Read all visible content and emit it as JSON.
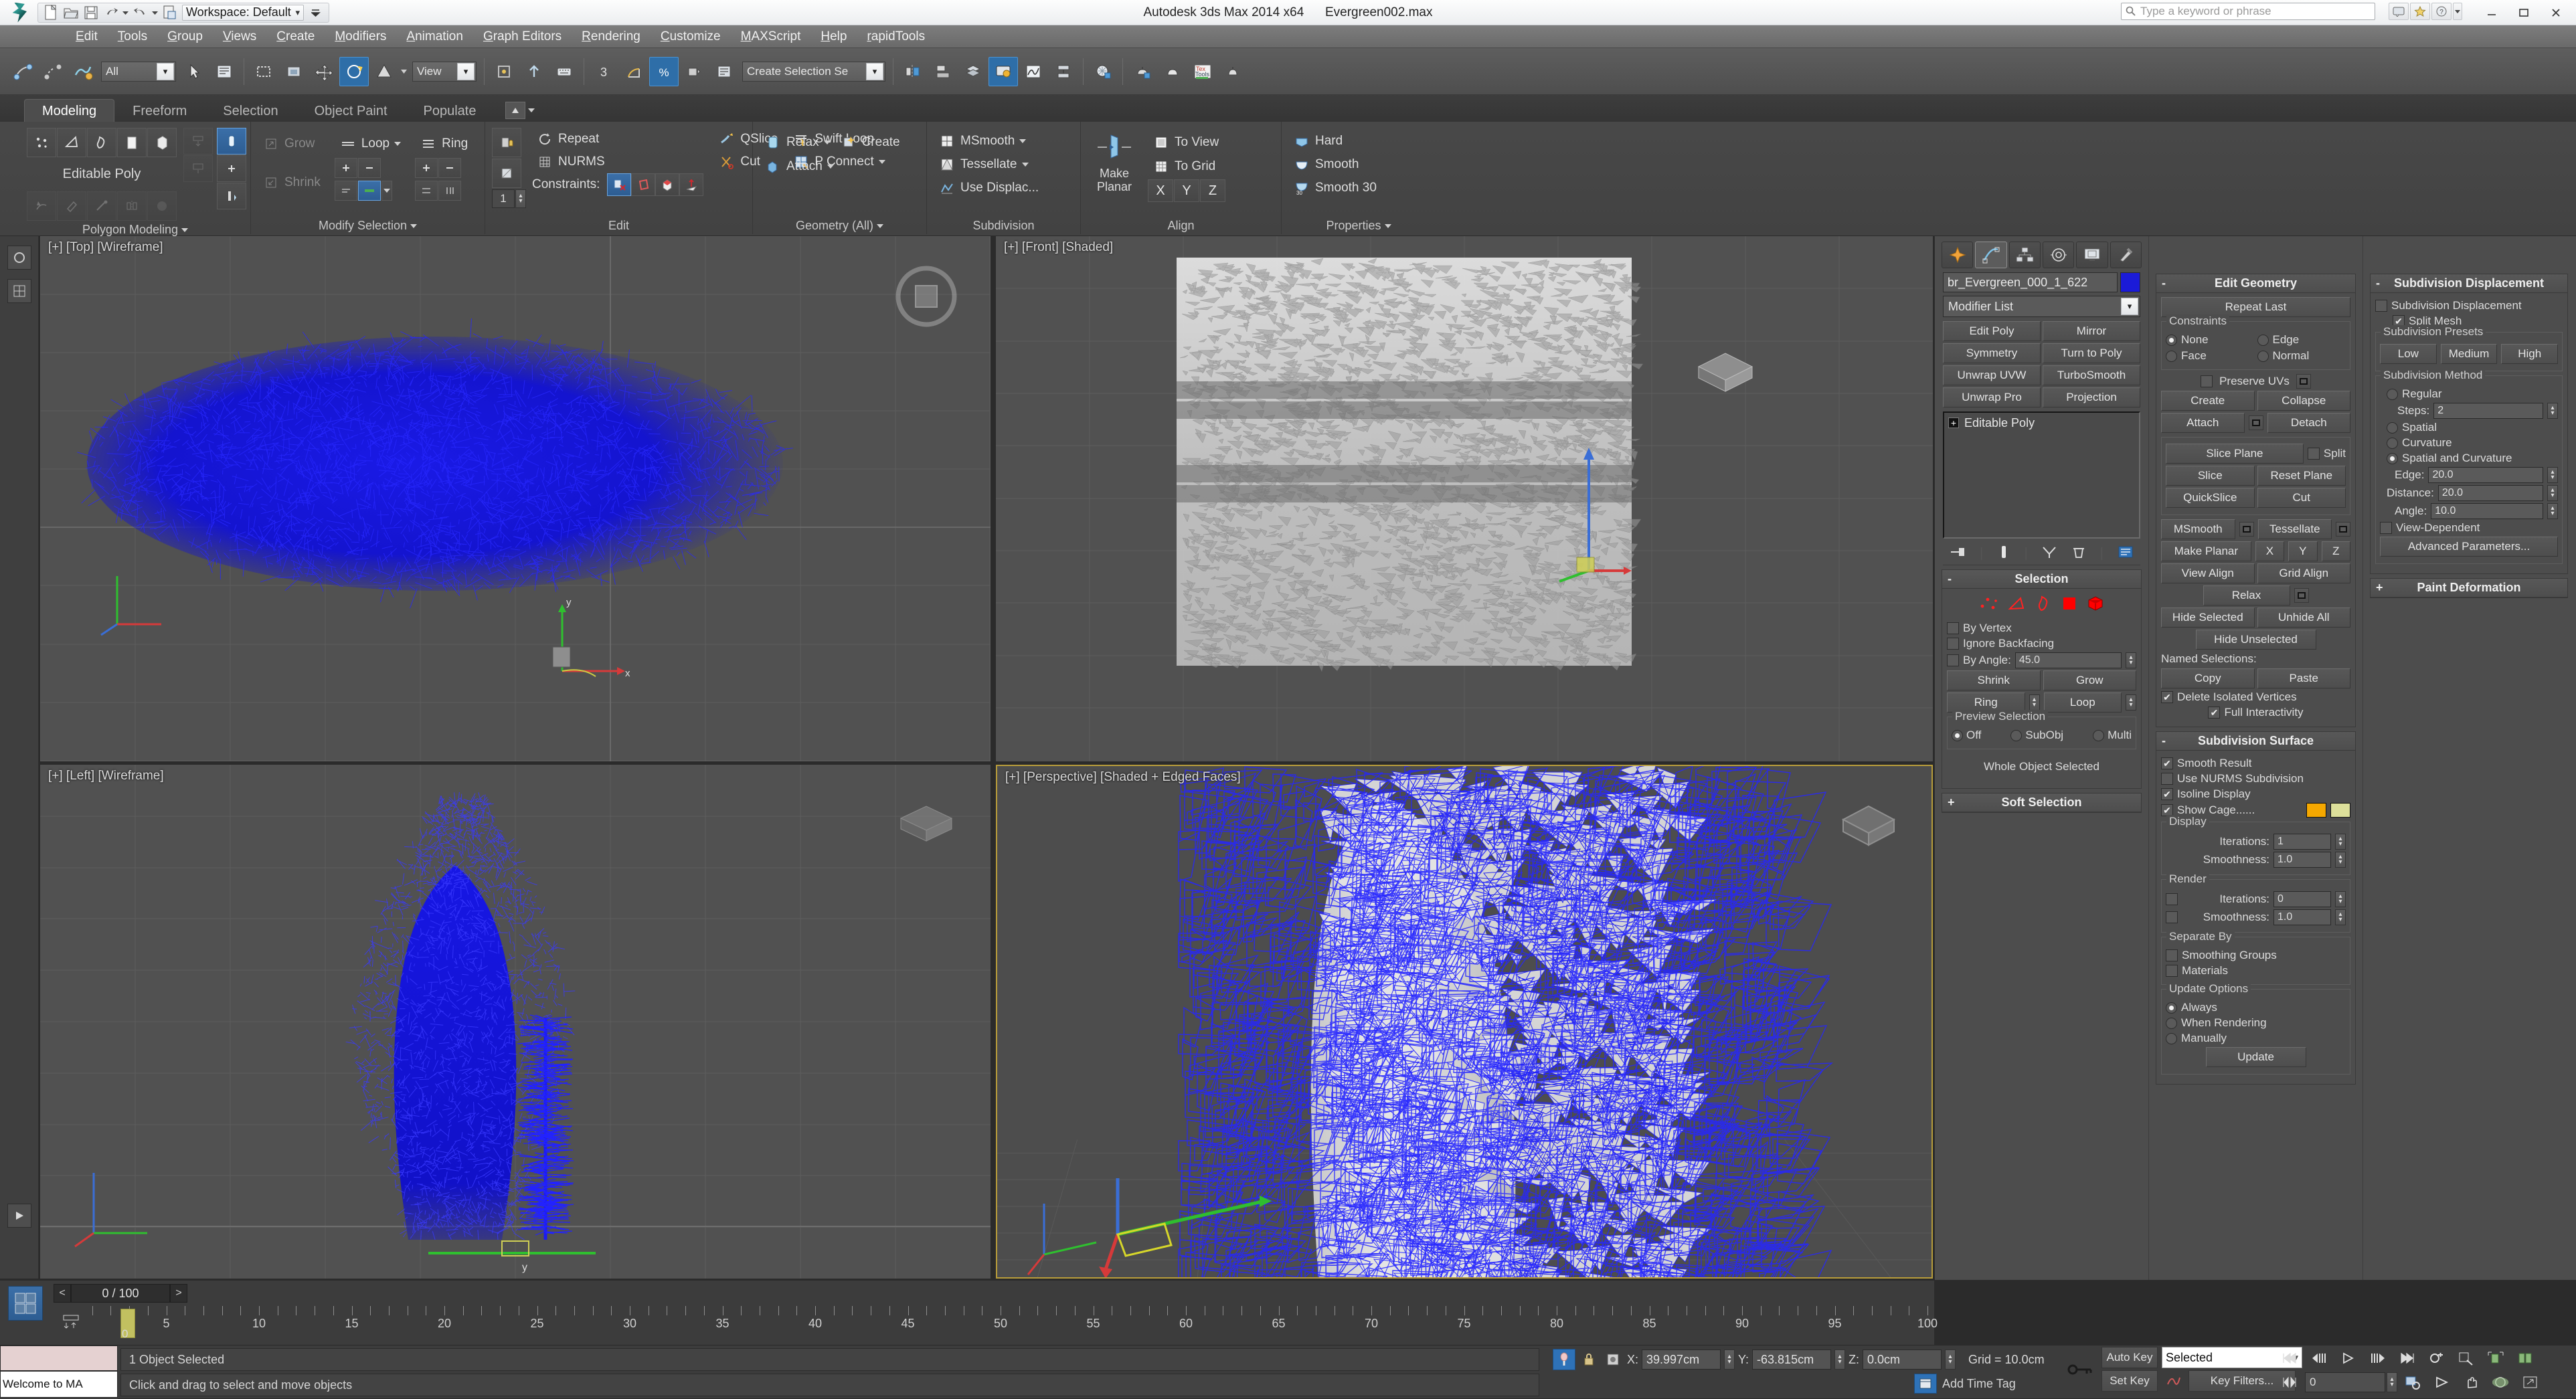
{
  "titlebar": {
    "app_title": "Autodesk 3ds Max  2014 x64",
    "file_name": "Evergreen002.max",
    "workspace_label": "Workspace: Default",
    "search_placeholder": "Type a keyword or phrase",
    "quick_access": [
      "new-icon",
      "open-icon",
      "save-icon",
      "undo-icon",
      "redo-icon",
      "project-icon"
    ],
    "window_buttons": [
      "minimize",
      "maximize",
      "close"
    ]
  },
  "menubar": {
    "items": [
      "Edit",
      "Tools",
      "Group",
      "Views",
      "Create",
      "Modifiers",
      "Animation",
      "Graph Editors",
      "Rendering",
      "Customize",
      "MAXScript",
      "Help",
      "rapidTools"
    ]
  },
  "maintoolbar": {
    "selection_set_value": "Create Selection Se",
    "count_value": "1"
  },
  "ribbon": {
    "tabs": [
      "Modeling",
      "Freeform",
      "Selection",
      "Object Paint",
      "Populate"
    ],
    "active_tab": "Modeling",
    "panels": [
      {
        "title": "Polygon Modeling",
        "label": "Editable Poly"
      },
      {
        "title": "Modify Selection",
        "buttons": [
          "Grow",
          "Shrink",
          "Loop",
          "Ring"
        ]
      },
      {
        "title": "Edit",
        "buttons": [
          "Repeat",
          "QSlice",
          "Swift Loop",
          "NURMS",
          "Cut",
          "P Connect"
        ],
        "constraints_label": "Constraints:"
      },
      {
        "title": "Geometry (All)",
        "buttons": [
          "Relax",
          "Create",
          "Attach"
        ]
      },
      {
        "title": "Subdivision",
        "buttons": [
          "MSmooth",
          "Tessellate",
          "Use Displac..."
        ]
      },
      {
        "title": "Align",
        "buttons": [
          "Make Planar",
          "To View",
          "To Grid"
        ],
        "axes": [
          "X",
          "Y",
          "Z"
        ]
      },
      {
        "title": "Properties",
        "buttons": [
          "Hard",
          "Smooth",
          "Smooth 30"
        ]
      }
    ]
  },
  "viewports": [
    {
      "label": "[+] [Top] [Wireframe]",
      "name": "viewport-top",
      "active": false
    },
    {
      "label": "[+] [Front] [Shaded]",
      "name": "viewport-front",
      "active": false
    },
    {
      "label": "[+] [Left] [Wireframe]",
      "name": "viewport-left",
      "active": false
    },
    {
      "label": "[+] [Perspective] [Shaded + Edged Faces]",
      "name": "viewport-perspective",
      "active": true
    }
  ],
  "command_panel": {
    "object_name": "br_Evergreen_000_1_622",
    "object_color": "#1b1bd8",
    "modifier_list_label": "Modifier List",
    "modifier_buttons": [
      "Edit Poly",
      "Mirror",
      "Symmetry",
      "Turn to Poly",
      "Unwrap UVW",
      "TurboSmooth",
      "Unwrap Pro",
      "Projection"
    ],
    "stack_items": [
      "Editable Poly"
    ],
    "selection": {
      "title": "Selection",
      "sub_object_icons": [
        "vertex-icon",
        "edge-icon",
        "border-icon",
        "polygon-icon",
        "element-icon"
      ],
      "by_vertex": {
        "label": "By Vertex",
        "checked": false
      },
      "ignore_backfacing": {
        "label": "Ignore Backfacing",
        "checked": false
      },
      "by_angle": {
        "label": "By Angle:",
        "checked": false,
        "value": "45.0"
      },
      "shrink_label": "Shrink",
      "grow_label": "Grow",
      "ring_label": "Ring",
      "loop_label": "Loop",
      "preview_selection": {
        "title": "Preview Selection",
        "options": [
          "Off",
          "SubObj",
          "Multi"
        ],
        "selected": "Off"
      },
      "status": "Whole Object Selected"
    },
    "soft_selection": {
      "title": "Soft Selection",
      "collapsed": true
    },
    "edit_geometry": {
      "title": "Edit Geometry",
      "repeat_last": "Repeat Last",
      "constraints": {
        "title": "Constraints",
        "options": [
          "None",
          "Edge",
          "Face",
          "Normal"
        ],
        "selected": "None"
      },
      "preserve_uvs": {
        "label": "Preserve UVs",
        "checked": false
      },
      "buttons_row1": [
        "Create",
        "Collapse"
      ],
      "buttons_row2": [
        "Attach",
        "Detach"
      ],
      "slice_group": [
        "Slice Plane",
        "Split",
        "Slice",
        "Reset Plane",
        "QuickSlice",
        "Cut"
      ],
      "split_checked": false,
      "msmooth": "MSmooth",
      "tessellate": "Tessellate",
      "make_planar": "Make Planar",
      "axes": [
        "X",
        "Y",
        "Z"
      ],
      "view_align": "View Align",
      "grid_align": "Grid Align",
      "relax": "Relax",
      "hide_selected": "Hide Selected",
      "unhide_all": "Unhide All",
      "hide_unselected": "Hide Unselected",
      "named_selections": "Named Selections:",
      "copy": "Copy",
      "paste": "Paste",
      "delete_isolated": {
        "label": "Delete Isolated Vertices",
        "checked": true
      },
      "full_interactivity": {
        "label": "Full Interactivity",
        "checked": true
      }
    },
    "subdivision_surface": {
      "title": "Subdivision Surface",
      "smooth_result": {
        "label": "Smooth Result",
        "checked": true
      },
      "use_nurms": {
        "label": "Use NURMS Subdivision",
        "checked": false
      },
      "isoline_display": {
        "label": "Isoline Display",
        "checked": true
      },
      "show_cage": {
        "label": "Show Cage......",
        "checked": true,
        "color1": "#f5a800",
        "color2": "#dde09a"
      },
      "display": {
        "title": "Display",
        "iterations_label": "Iterations:",
        "iterations_value": "1",
        "smoothness_label": "Smoothness:",
        "smoothness_value": "1.0"
      },
      "render": {
        "title": "Render",
        "iterations_label": "Iterations:",
        "iterations_value": "0",
        "iterations_checked": false,
        "smoothness_label": "Smoothness:",
        "smoothness_value": "1.0",
        "smoothness_checked": false
      },
      "separate_by": {
        "title": "Separate By",
        "smoothing_groups": {
          "label": "Smoothing Groups",
          "checked": false
        },
        "materials": {
          "label": "Materials",
          "checked": false
        }
      },
      "update_options": {
        "title": "Update Options",
        "options": [
          "Always",
          "When Rendering",
          "Manually"
        ],
        "selected": "Always",
        "update_button": "Update"
      }
    },
    "subdivision_displacement": {
      "title": "Subdivision Displacement",
      "enable": {
        "label": "Subdivision Displacement",
        "checked": false
      },
      "split_mesh": {
        "label": "Split Mesh",
        "checked": true
      },
      "presets": {
        "title": "Subdivision Presets",
        "buttons": [
          "Low",
          "Medium",
          "High"
        ]
      },
      "method": {
        "title": "Subdivision Method",
        "options": [
          "Regular",
          "Spatial",
          "Curvature",
          "Spatial and Curvature"
        ],
        "selected": "Spatial and Curvature",
        "steps_label": "Steps:",
        "steps_value": "2",
        "edge_label": "Edge:",
        "edge_value": "20.0",
        "distance_label": "Distance:",
        "distance_value": "20.0",
        "angle_label": "Angle:",
        "angle_value": "10.0",
        "view_dependent": {
          "label": "View-Dependent",
          "checked": false
        },
        "advanced": "Advanced Parameters..."
      }
    },
    "paint_deformation": {
      "title": "Paint Deformation",
      "collapsed": true
    }
  },
  "trackbar": {
    "frame_display": "0 / 100",
    "prev_label": "<",
    "next_label": ">",
    "ticks": [
      "5",
      "10",
      "15",
      "20",
      "25",
      "30",
      "35",
      "40",
      "45",
      "50",
      "55",
      "60",
      "65",
      "70",
      "75",
      "80",
      "85",
      "90",
      "95",
      "100"
    ],
    "current_frame": "0"
  },
  "statusbar": {
    "listener_text": "Welcome to MA",
    "selection_status": "1 Object Selected",
    "prompt": "Click and drag to select and move objects",
    "coords": {
      "x_label": "X:",
      "x_value": "39.997cm",
      "y_label": "Y:",
      "y_value": "-63.815cm",
      "z_label": "Z:",
      "z_value": "0.0cm"
    },
    "grid_label": "Grid = 10.0cm",
    "auto_key": "Auto Key",
    "set_key": "Set Key",
    "key_mode_value": "Selected",
    "key_filters": "Key Filters...",
    "time_value": "0",
    "add_time_tag": "Add Time Tag"
  }
}
